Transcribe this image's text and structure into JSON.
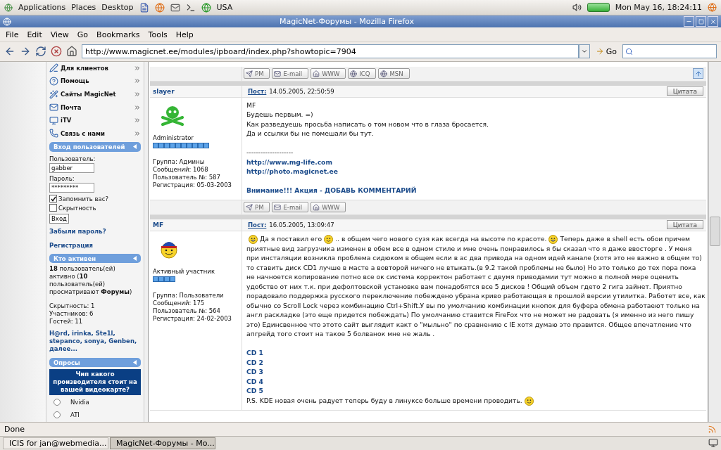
{
  "top_panel": {
    "menus": [
      "Applications",
      "Places",
      "Desktop"
    ],
    "keyboard": "USA",
    "clock": "Mon May 16, 18:24:11"
  },
  "window": {
    "title": "MagicNet-Форумы - Mozilla Firefox"
  },
  "menu_bar": [
    "File",
    "Edit",
    "View",
    "Go",
    "Bookmarks",
    "Tools",
    "Help"
  ],
  "address": {
    "value": "http://www.magicnet.ee/modules/ipboard/index.php?showtopic=7904",
    "go": "Go"
  },
  "sidebar": {
    "nav": [
      {
        "label": "Для клиентов",
        "kind": "pen"
      },
      {
        "label": "Помощь",
        "kind": "help"
      },
      {
        "label": "Сайты MagicNet",
        "kind": "wand"
      },
      {
        "label": "Почта",
        "kind": "mail"
      },
      {
        "label": "iTV",
        "kind": "monitor"
      },
      {
        "label": "Связь с нами",
        "kind": "phone"
      }
    ],
    "login": {
      "title": "Вход пользователей",
      "user_label": "Пользователь:",
      "user_value": "gabber",
      "pass_label": "Пароль:",
      "pass_value": "*********",
      "remember": {
        "label": "Запомнить вас?",
        "checked": true
      },
      "hidden": {
        "label": "Скрытность",
        "checked": false
      },
      "submit": "Вход",
      "forgot": "Забыли пароль?",
      "register": "Регистрация"
    },
    "active": {
      "title": "Кто активен",
      "summary": "**18** пользователь(ей) активно (**10** пользователь(ей) просматривают **Форумы**)",
      "stats": [
        "Скрытность: 1",
        "Участников: 6",
        "Гостей: 11"
      ],
      "users": "H@rd, irinka, Ste1l, stepanco, sonya, Genben, далее..."
    },
    "poll": {
      "title": "Опросы",
      "question": "Чип какого производителя стоит на вашей видеокарте?",
      "options": [
        {
          "label": "Nvidia",
          "selected": false
        },
        {
          "label": "ATI",
          "selected": false
        }
      ]
    }
  },
  "previous_post_buttons": {
    "buttons": [
      "PM",
      "E-mail",
      "WWW",
      "ICQ",
      "MSN"
    ],
    "to_top": true
  },
  "posts": [
    {
      "author": "slayer",
      "post_label": "Пост:",
      "date": "14.05.2005, 22:50:59",
      "quote": "Цитата",
      "role": "Administrator",
      "stars": 10,
      "info": [
        "Группа: Админы",
        "Сообщений: 1068",
        "Пользователь №: 587",
        "Регистрация: 05-03-2003"
      ],
      "body": [
        {
          "kind": "line",
          "text": "MF"
        },
        {
          "kind": "line",
          "text": "Будешь первым. =)"
        },
        {
          "kind": "line",
          "text": "Как разведуешь просьба написать о том новом что в глаза бросается."
        },
        {
          "kind": "line",
          "text": "Да и ссылки бы не помешали бы тут."
        },
        {
          "kind": "gap"
        },
        {
          "kind": "line",
          "text": "--------------------"
        },
        {
          "kind": "link",
          "text": "http://www.mg-life.com"
        },
        {
          "kind": "link",
          "text": "http://photo.magicnet.ee"
        },
        {
          "kind": "gap"
        },
        {
          "kind": "link",
          "text": "Внимание!!! Акция - ДОБАВЬ КОММЕНТАРИЙ"
        }
      ],
      "buttons": [
        "PM",
        "E-mail",
        "WWW"
      ]
    },
    {
      "author": "MF",
      "post_label": "Пост:",
      "date": "16.05.2005, 13:09:47",
      "quote": "Цитата",
      "role": "Активный участник",
      "stars": 4,
      "info": [
        "Группа: Пользователи",
        "Сообщений: 175",
        "Пользователь №: 564",
        "Регистрация: 24-02-2003"
      ],
      "body": [
        {
          "kind": "paragraph",
          "parts": [
            {
              "kind": "smiley"
            },
            {
              "kind": "text",
              "text": "Да я поставил его"
            },
            {
              "kind": "smiley"
            },
            {
              "kind": "text",
              "text": ".. в общем чего нового сузя как всегда на высоте по красоте."
            },
            {
              "kind": "smiley"
            },
            {
              "kind": "text",
              "text": "Теперь даже в shell есть обои причем приятные вид загрузчика изменен в обем все в одном стиле и мне очень понравилось я бы сказал что я даже ввосторге . У меня при инсталяции возникла проблема сидюком в общем если в ас два привода на одном идей канале (хотя это не важно в общем то) то ставить диск CD1 лучше в масте а вовторой ничего не втыкать.(в 9.2 такой проблемы не было) Но это только до тех пора пока не начнoется копирование потно все ок система корректон работает с двумя приводамии тут можно в полной мере оценить удобство от них т.к. при дефолтовской установке вам понадобятся все 5 дисков ! Общий объем гдето 2 гига зайнет. Приятно порадовало поддержка русского переключение побеждено убрана криво работающая в прошлой версии утилитка. Работет все, как обычно со Scroll Lock через комбинацию Ctrl+Shift.У вы по умолчанию комбинации кнопок для буфера обмена работаеют только на англ раскладке (это еще придется побеждать) По умолчанию ставится FireFox что не может не радовать (я именно из него пишу это) Единсвенное что этото сайт выглядит какт о \"мыльно\" по сравнению с IE хотя думаю это правится. Общее впечатление что апгрейд того стоит на такое 5 болванок мне не жаль ."
            }
          ]
        },
        {
          "kind": "gap"
        },
        {
          "kind": "link",
          "text": "CD 1"
        },
        {
          "kind": "link",
          "text": "CD 2"
        },
        {
          "kind": "link",
          "text": "CD 3"
        },
        {
          "kind": "link",
          "text": "CD 4"
        },
        {
          "kind": "link",
          "text": "CD 5"
        },
        {
          "kind": "paragraph",
          "parts": [
            {
              "kind": "text",
              "text": "P.S. KDE новая очень радует теперь буду в линуксе больше времени проводить."
            },
            {
              "kind": "smiley"
            }
          ]
        }
      ]
    }
  ],
  "status_bar": {
    "text": "Done"
  },
  "taskbar": [
    {
      "label": "ICIS for jan@webmedia...",
      "selected": false
    },
    {
      "label": "MagicNet-Форумы - Mo...",
      "selected": true
    }
  ]
}
